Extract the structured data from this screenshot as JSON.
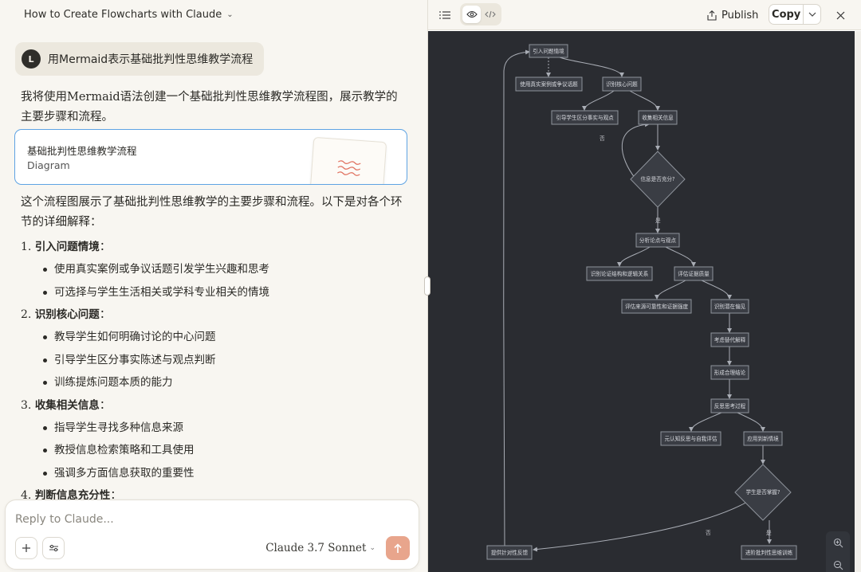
{
  "chat": {
    "title": "How to Create Flowcharts with Claude",
    "user_initial": "L",
    "user_message": "用Mermaid表示基础批判性思维教学流程",
    "intro_line1": "我将使用Mermaid语法创建一个基础批判性思维教学流程图，展示教学的",
    "intro_line2": "主要步骤和流程。",
    "artifact": {
      "title": "基础批判性思维教学流程",
      "type": "Diagram"
    },
    "body_line1": "这个流程图展示了基础批判性思维教学的主要步骤和流程。以下是对各个环",
    "body_line2": "节的详细解释：",
    "sections": [
      {
        "num": "1.",
        "title": "引入问题情境",
        "colon": "：",
        "bullets": [
          "使用真实案例或争议话题引发学生兴趣和思考",
          "可选择与学生生活相关或学科专业相关的情境"
        ]
      },
      {
        "num": "2.",
        "title": "识别核心问题",
        "colon": "：",
        "bullets": [
          "教导学生如何明确讨论的中心问题",
          "引导学生区分事实陈述与观点判断",
          "训练提炼问题本质的能力"
        ]
      },
      {
        "num": "3.",
        "title": "收集相关信息",
        "colon": "：",
        "bullets": [
          "指导学生寻找多种信息来源",
          "教授信息检索策略和工具使用",
          "强调多方面信息获取的重要性"
        ]
      },
      {
        "num": "4.",
        "title": "判断信息充分性",
        "colon": "：",
        "bullets": []
      }
    ],
    "composer": {
      "placeholder": "Reply to Claude...",
      "model": "Claude 3.7 Sonnet"
    }
  },
  "artifact_panel": {
    "publish_label": "Publish",
    "copy_label": "Copy",
    "flowchart": {
      "nodes": {
        "n1": "引入问题情境",
        "n2": "使用真实案例或争议话题",
        "n3": "识别核心问题",
        "n4": "引导学生区分事实与观点",
        "n5": "收集相关信息",
        "n6": "信息是否充分?",
        "n7": "分析论点与观点",
        "n8": "识别论证结构和逻辑关系",
        "n9": "评估证据质量",
        "n10": "评估来源可靠性和证据强度",
        "n11": "识别潜在偏见",
        "n12": "考虑替代解释",
        "n13": "形成合理结论",
        "n14": "反思思考过程",
        "n15": "元认知反思与自我评估",
        "n16": "应用到新情境",
        "n17": "学生是否掌握?",
        "n18": "提供针对性反馈",
        "n19": "进阶批判性思维训练"
      },
      "edge_labels": {
        "no1": "否",
        "yes1": "是",
        "no2": "否",
        "yes2": "是"
      }
    }
  },
  "colors": {
    "accent_blue": "#5ea3e3",
    "send_button": "#e8a58c",
    "canvas_bg": "#2a2c31"
  }
}
